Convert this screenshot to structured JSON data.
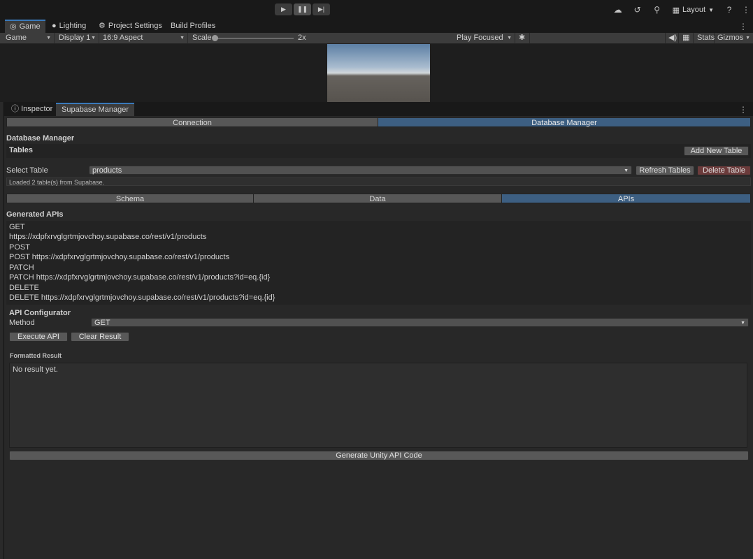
{
  "toolbar": {
    "layout_label": "Layout"
  },
  "game_tabs": [
    "Game",
    "Lighting",
    "Project Settings",
    "Build Profiles"
  ],
  "gamebar": {
    "view": "Game",
    "display": "Display 1",
    "aspect": "16:9 Aspect",
    "scale_label": "Scale",
    "scale_value": "2x",
    "play_mode": "Play Focused",
    "stats": "Stats",
    "gizmos": "Gizmos"
  },
  "inspector_tabs": [
    "Inspector",
    "Supabase Manager"
  ],
  "main_tabs": [
    "Connection",
    "Database Manager"
  ],
  "db": {
    "header": "Database Manager",
    "tables_label": "Tables",
    "add_table": "Add New Table",
    "select_label": "Select Table",
    "selected_table": "products",
    "refresh": "Refresh Tables",
    "delete": "Delete Table",
    "status": "Loaded 2 table(s) from Supabase."
  },
  "sub_tabs": [
    "Schema",
    "Data",
    "APIs"
  ],
  "apis": {
    "header": "Generated APIs",
    "lines": [
      " GET",
      "https://xdpfxrvglgrtmjovchoy.supabase.co/rest/v1/products",
      " POST",
      "POST https://xdpfxrvglgrtmjovchoy.supabase.co/rest/v1/products",
      " PATCH",
      "PATCH https://xdpfxrvglgrtmjovchoy.supabase.co/rest/v1/products?id=eq.{id}",
      " DELETE",
      "DELETE https://xdpfxrvglgrtmjovchoy.supabase.co/rest/v1/products?id=eq.{id}"
    ]
  },
  "configurator": {
    "header": "API Configurator",
    "method_label": "Method",
    "method_value": "GET",
    "execute": "Execute API",
    "clear": "Clear Result",
    "result_label": "Formatted Result",
    "result_text": "No result yet.",
    "generate": "Generate Unity API Code"
  }
}
